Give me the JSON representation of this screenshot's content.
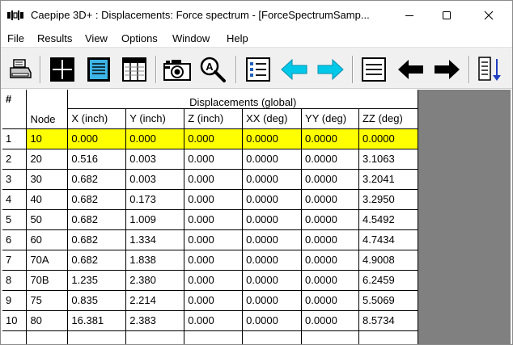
{
  "window": {
    "title": "Caepipe 3D+ : Displacements: Force spectrum -  [ForceSpectrumSamp..."
  },
  "menu": [
    "File",
    "Results",
    "View",
    "Options",
    "Window",
    "Help"
  ],
  "toolbar": {
    "icons": [
      "printer-icon",
      "crosshair-icon",
      "document-icon",
      "table-icon",
      "camera-icon",
      "zoom-icon",
      "list-icon",
      "arrow-left-cyan-icon",
      "arrow-right-cyan-icon",
      "lines-icon",
      "arrow-left-black-icon",
      "arrow-right-black-icon",
      "sort-down-icon"
    ]
  },
  "colors": {
    "highlight": "#ffff00",
    "cyan_arrow": "#00c8e8",
    "background_gray": "#808080"
  },
  "table": {
    "corner": "#",
    "group_header": "Displacements (global)",
    "columns": [
      "Node",
      "X (inch)",
      "Y (inch)",
      "Z (inch)",
      "XX (deg)",
      "YY (deg)",
      "ZZ (deg)"
    ],
    "rows": [
      {
        "num": "1",
        "cells": [
          "10",
          "0.000",
          "0.000",
          "0.000",
          "0.0000",
          "0.0000",
          "0.0000"
        ]
      },
      {
        "num": "2",
        "cells": [
          "20",
          "0.516",
          "0.003",
          "0.000",
          "0.0000",
          "0.0000",
          "3.1063"
        ]
      },
      {
        "num": "3",
        "cells": [
          "30",
          "0.682",
          "0.003",
          "0.000",
          "0.0000",
          "0.0000",
          "3.2041"
        ]
      },
      {
        "num": "4",
        "cells": [
          "40",
          "0.682",
          "0.173",
          "0.000",
          "0.0000",
          "0.0000",
          "3.2950"
        ]
      },
      {
        "num": "5",
        "cells": [
          "50",
          "0.682",
          "1.009",
          "0.000",
          "0.0000",
          "0.0000",
          "4.5492"
        ]
      },
      {
        "num": "6",
        "cells": [
          "60",
          "0.682",
          "1.334",
          "0.000",
          "0.0000",
          "0.0000",
          "4.7434"
        ]
      },
      {
        "num": "7",
        "cells": [
          "70A",
          "0.682",
          "1.838",
          "0.000",
          "0.0000",
          "0.0000",
          "4.9008"
        ]
      },
      {
        "num": "8",
        "cells": [
          "70B",
          "1.235",
          "2.380",
          "0.000",
          "0.0000",
          "0.0000",
          "6.2459"
        ]
      },
      {
        "num": "9",
        "cells": [
          "75",
          "0.835",
          "2.214",
          "0.000",
          "0.0000",
          "0.0000",
          "5.5069"
        ]
      },
      {
        "num": "10",
        "cells": [
          "80",
          "16.381",
          "2.383",
          "0.000",
          "0.0000",
          "0.0000",
          "8.5734"
        ]
      }
    ],
    "highlighted_row": 0
  }
}
